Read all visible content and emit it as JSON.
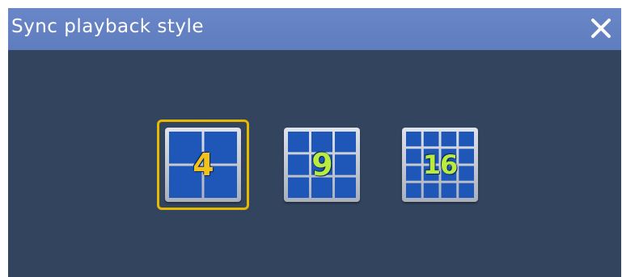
{
  "window": {
    "title": "Sync playback style",
    "close_icon": "close-icon"
  },
  "layout_options": [
    {
      "label": "4",
      "grid": 2,
      "selected": true,
      "number_color": "#f2c21a"
    },
    {
      "label": "9",
      "grid": 3,
      "selected": false,
      "number_color": "#b9ec3e"
    },
    {
      "label": "16",
      "grid": 4,
      "selected": false,
      "number_color": "#b9ec3e"
    }
  ],
  "colors": {
    "title_bar": "#6585c6",
    "body": "#33445f",
    "selection": "#e6b800",
    "cell": "#1e57b8"
  }
}
